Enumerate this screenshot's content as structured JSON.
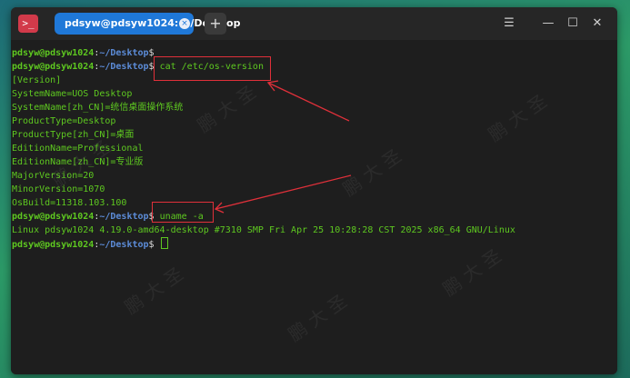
{
  "window": {
    "tab_title": "pdsyw@pdsyw1024: ~/Desktop",
    "tab_close_glyph": "×",
    "new_tab_glyph": "+",
    "menu_glyph": "☰",
    "minimize_glyph": "—",
    "maximize_glyph": "☐",
    "close_glyph": "✕",
    "app_icon_glyph": ">_"
  },
  "colors": {
    "accent": "#1f78d8",
    "prompt_user": "#5ec820",
    "prompt_path": "#5c8cd8",
    "output": "#5ec820",
    "annotation": "#e0303a"
  },
  "terminal": {
    "prompt_user": "pdsyw@pdsyw1024",
    "prompt_sep": ":",
    "prompt_path": "~/Desktop",
    "prompt_sym": "$ ",
    "lines": [
      {
        "type": "prompt",
        "cmd": ""
      },
      {
        "type": "prompt",
        "cmd": "cat /etc/os-version"
      },
      {
        "type": "out",
        "text": "[Version]"
      },
      {
        "type": "out",
        "text": "SystemName=UOS Desktop"
      },
      {
        "type": "out",
        "text": "SystemName[zh_CN]=统信桌面操作系统"
      },
      {
        "type": "out",
        "text": "ProductType=Desktop"
      },
      {
        "type": "out",
        "text": "ProductType[zh_CN]=桌面"
      },
      {
        "type": "out",
        "text": "EditionName=Professional"
      },
      {
        "type": "out",
        "text": "EditionName[zh_CN]=专业版"
      },
      {
        "type": "out",
        "text": "MajorVersion=20"
      },
      {
        "type": "out",
        "text": "MinorVersion=1070"
      },
      {
        "type": "out",
        "text": "OsBuild=11318.103.100"
      },
      {
        "type": "prompt",
        "cmd": "uname -a"
      },
      {
        "type": "out",
        "text": "Linux pdsyw1024 4.19.0-amd64-desktop #7310 SMP Fri Apr 25 10:28:28 CST 2025 x86_64 GNU/Linux"
      },
      {
        "type": "prompt",
        "cmd": "",
        "cursor": true
      }
    ]
  },
  "watermark_text": "鹏 大 圣"
}
